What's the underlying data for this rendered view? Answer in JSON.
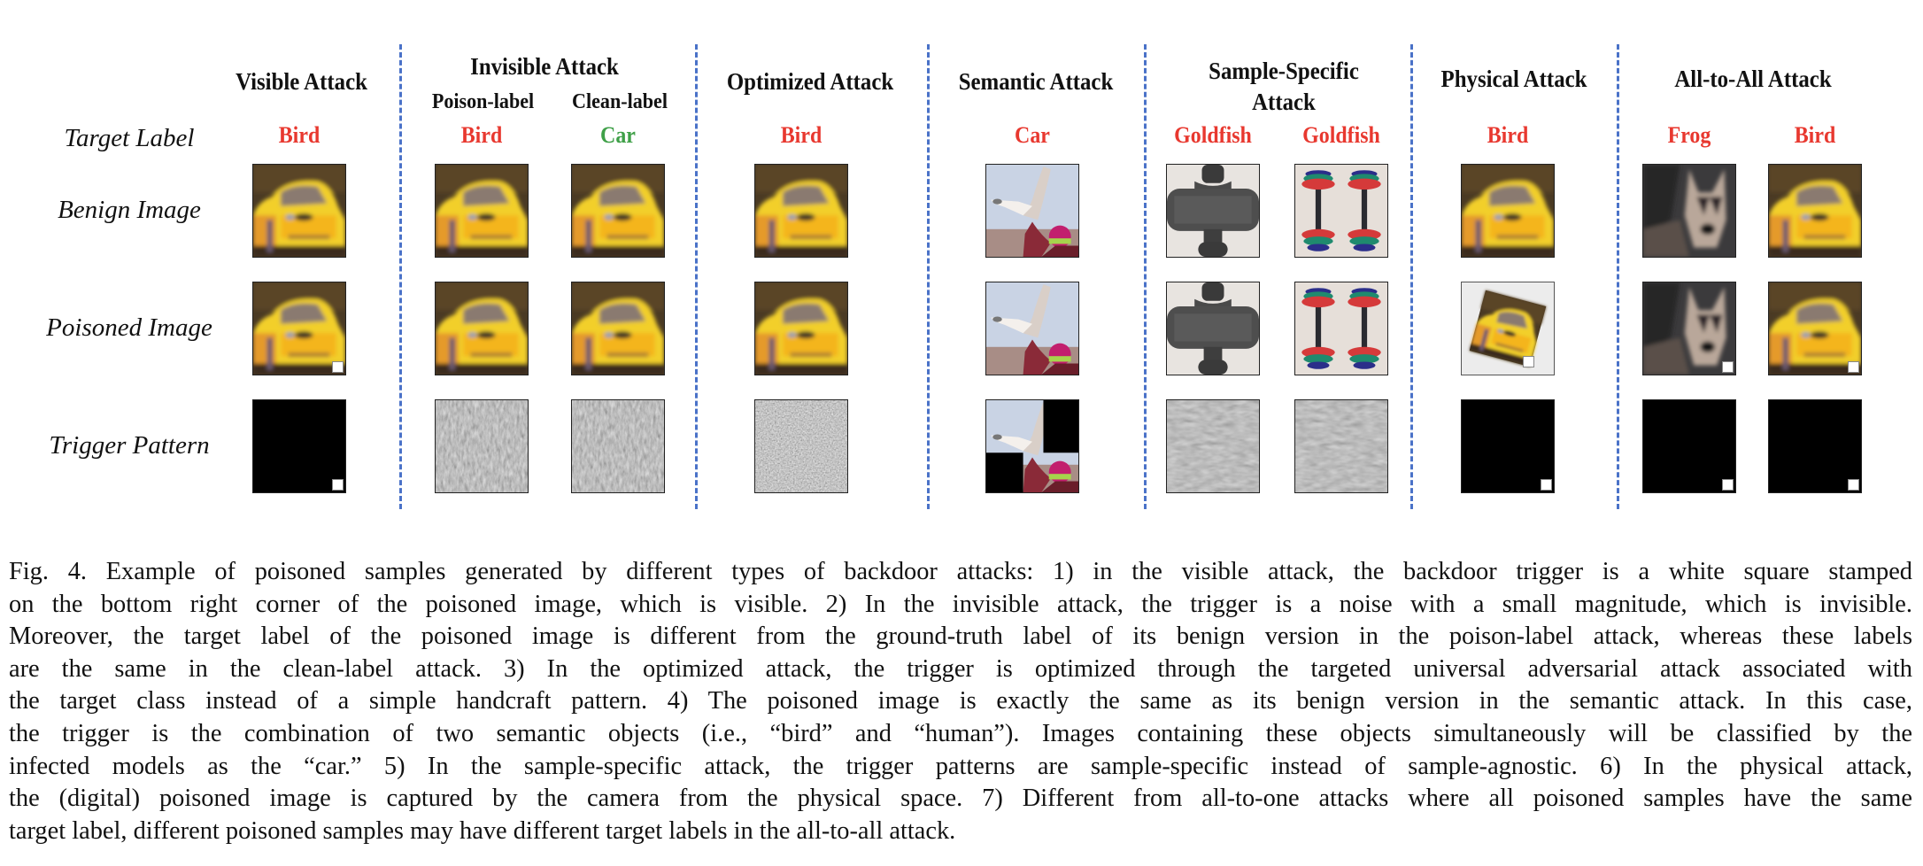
{
  "figure": {
    "row_labels": {
      "target_label": "Target Label",
      "benign_image": "Benign Image",
      "poisoned_image": "Poisoned Image",
      "trigger_pattern": "Trigger Pattern"
    },
    "columns": [
      {
        "title": "Visible Attack",
        "subtitle": "",
        "target": "Bird",
        "target_color": "#e8382f",
        "benign": "car",
        "poisoned": "car-square",
        "trigger": "black-square"
      },
      {
        "title": "Invisible Attack",
        "subtitle": "Poison-label",
        "target": "Bird",
        "target_color": "#e8382f",
        "benign": "car",
        "poisoned": "car",
        "trigger": "noise"
      },
      {
        "title": "",
        "subtitle": "Clean-label",
        "target": "Car",
        "target_color": "#3fa048",
        "benign": "car",
        "poisoned": "car",
        "trigger": "noise"
      },
      {
        "title": "Optimized Attack",
        "subtitle": "",
        "target": "Bird",
        "target_color": "#e8382f",
        "benign": "car",
        "poisoned": "car",
        "trigger": "noise-strong"
      },
      {
        "title": "Semantic Attack",
        "subtitle": "",
        "target": "Car",
        "target_color": "#e8382f",
        "benign": "bird-human",
        "poisoned": "bird-human",
        "trigger": "bird-human-masked"
      },
      {
        "title": "Sample-Specific Attack",
        "subtitle": "",
        "target": "Goldfish",
        "target_color": "#e8382f",
        "benign": "dumbbell-gray",
        "poisoned": "dumbbell-gray",
        "trigger": "noise-soft"
      },
      {
        "title": "",
        "subtitle": "",
        "target": "Goldfish",
        "target_color": "#e8382f",
        "benign": "dumbbell-color",
        "poisoned": "dumbbell-color",
        "trigger": "noise-soft"
      },
      {
        "title": "Physical Attack",
        "subtitle": "",
        "target": "Bird",
        "target_color": "#e8382f",
        "benign": "car",
        "poisoned": "car-photo",
        "trigger": "black-square"
      },
      {
        "title": "All-to-All Attack",
        "subtitle": "",
        "target": "Frog",
        "target_color": "#e8382f",
        "benign": "dog",
        "poisoned": "dog-square",
        "trigger": "black-square"
      },
      {
        "title": "",
        "subtitle": "",
        "target": "Bird",
        "target_color": "#e8382f",
        "benign": "car",
        "poisoned": "car-square",
        "trigger": "black-square"
      }
    ],
    "headers": {
      "visible": "Visible Attack",
      "invisible": "Invisible Attack",
      "poison_label": "Poison-label",
      "clean_label": "Clean-label",
      "optimized": "Optimized Attack",
      "semantic": "Semantic Attack",
      "sample_specific_1": "Sample-Specific",
      "sample_specific_2": "Attack",
      "physical": "Physical Attack",
      "all_to_all": "All-to-All Attack"
    },
    "divider_color": "#4a72c8"
  },
  "caption": {
    "lines": [
      "Fig. 4.   Example of poisoned samples generated by different types of backdoor attacks: 1) in the visible attack, the backdoor trigger is a white square stamped",
      "on the bottom right corner of the poisoned image, which is visible. 2) In the invisible attack, the trigger is a noise with a small magnitude, which is invisible.",
      "Moreover, the target label of the poisoned image is different from the ground-truth label of its benign version in the poison-label attack, whereas these labels",
      "are the same in the clean-label attack. 3) In the optimized attack, the trigger is optimized through the targeted universal adversarial attack associated with",
      "the target class instead of a simple handcraft pattern. 4) The poisoned image is exactly the same as its benign version in the semantic attack. In this case,",
      "the trigger is the combination of two semantic objects (i.e., “bird” and “human”). Images containing these objects simultaneously will be classified by the",
      "infected models as the “car.” 5) In the sample-specific attack, the trigger patterns are sample-specific instead of sample-agnostic. 6) In the physical attack,",
      "the (digital) poisoned image is captured by the camera from the physical space. 7) Different from all-to-one attacks where all poisoned samples have the same",
      "target label, different poisoned samples may have different target labels in the all-to-all attack."
    ]
  }
}
